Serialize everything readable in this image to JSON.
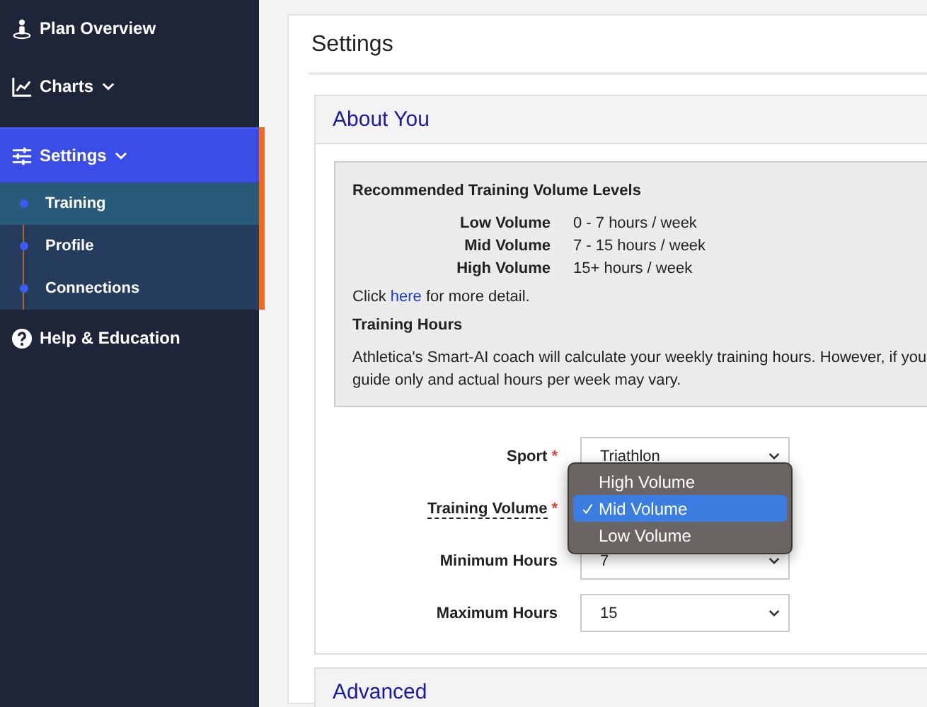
{
  "sidebar": {
    "items": [
      {
        "label": "Plan Overview",
        "selected": false
      },
      {
        "label": "Charts",
        "selected": false,
        "dropdown": true
      },
      {
        "label": "Settings",
        "selected": true,
        "dropdown": true,
        "expanded": true,
        "children": [
          {
            "label": "Training",
            "selected": true
          },
          {
            "label": "Profile",
            "selected": false
          },
          {
            "label": "Connections",
            "selected": false
          }
        ]
      },
      {
        "label": "Help & Education",
        "selected": false
      }
    ]
  },
  "page": {
    "title": "Settings"
  },
  "about_panel": {
    "title": "About You",
    "info": {
      "heading": "Recommended Training Volume Levels",
      "levels": [
        {
          "name": "Low Volume",
          "range": "0 - 7 hours / week"
        },
        {
          "name": "Mid Volume",
          "range": "7 - 15 hours / week"
        },
        {
          "name": "High Volume",
          "range": "15+ hours / week"
        }
      ],
      "link_before": "Click",
      "link": "here",
      "link_after": "for more detail.",
      "subheading": "Training Hours",
      "lines": [
        "Athletica's Smart-AI coach will calculate your weekly training hours. However, if you",
        "guide only and actual hours per week may vary."
      ]
    },
    "fields": [
      {
        "label": "Sport",
        "required_mark": "*",
        "hint": false,
        "value": "Triathlon"
      },
      {
        "label": "Training Volume",
        "required_mark": "*",
        "hint": true,
        "open": true,
        "options": [
          {
            "label": "High Volume",
            "selected": false
          },
          {
            "label": "Mid Volume",
            "selected": true
          },
          {
            "label": "Low Volume",
            "selected": false
          }
        ]
      },
      {
        "label": "Minimum Hours",
        "hint": false,
        "value": "7"
      },
      {
        "label": "Maximum Hours",
        "hint": false,
        "value": "15"
      }
    ]
  },
  "advanced_panel": {
    "title": "Advanced"
  }
}
